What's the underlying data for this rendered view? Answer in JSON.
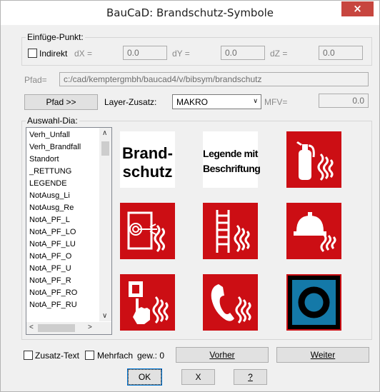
{
  "window": {
    "title": "BauCaD: Brandschutz-Symbole",
    "close_label": "×"
  },
  "insert": {
    "group_label": "Einfüge-Punkt:",
    "indirect_label": "Indirekt",
    "dx_label": "dX =",
    "dx_value": "0.0",
    "dy_label": "dY =",
    "dy_value": "0.0",
    "dz_label": "dZ =",
    "dz_value": "0.0"
  },
  "path": {
    "label": "Pfad=",
    "value": "c:/cad/kemptergmbh/baucad4/v/bibsym/brandschutz",
    "button_label": "Pfad >>"
  },
  "layer": {
    "label": "Layer-Zusatz:",
    "value": "MAKRO",
    "mfv_label": "MFV=",
    "mfv_value": "0.0"
  },
  "selection": {
    "group_label": "Auswahl-Dia:",
    "items": [
      "Verh_Unfall",
      "Verh_Brandfall",
      "Standort",
      "_RETTUNG",
      "LEGENDE",
      "NotAusg_Li",
      "NotAusg_Re",
      "NotA_PF_L",
      "NotA_PF_LO",
      "NotA_PF_LU",
      "NotA_PF_O",
      "NotA_PF_U",
      "NotA_PF_R",
      "NotA_PF_RO",
      "NotA_PF_RU"
    ],
    "symbols": [
      {
        "icon": "brandschutz-text-icon",
        "line1": "Brand-",
        "line2": "schutz"
      },
      {
        "icon": "legende-text-icon",
        "line1": "Legende mit",
        "line2": "Beschriftung"
      },
      {
        "icon": "fire-extinguisher-icon"
      },
      {
        "icon": "fire-hose-icon"
      },
      {
        "icon": "fire-ladder-icon"
      },
      {
        "icon": "fire-alarm-bell-icon"
      },
      {
        "icon": "fire-alarm-button-icon"
      },
      {
        "icon": "fire-telephone-icon"
      },
      {
        "icon": "blue-target-icon"
      }
    ]
  },
  "footer": {
    "zusatz_label": "Zusatz-Text",
    "mehrfach_label": "Mehrfach",
    "count_text": "gew.: 0",
    "prev_label": "Vorher",
    "next_label": "Weiter",
    "ok_label": "OK",
    "x_label": "X",
    "help_label": "?"
  },
  "colors": {
    "sign_red": "#cc0e14",
    "blue_sign": "#1479a8",
    "close_red": "#c7463f"
  }
}
